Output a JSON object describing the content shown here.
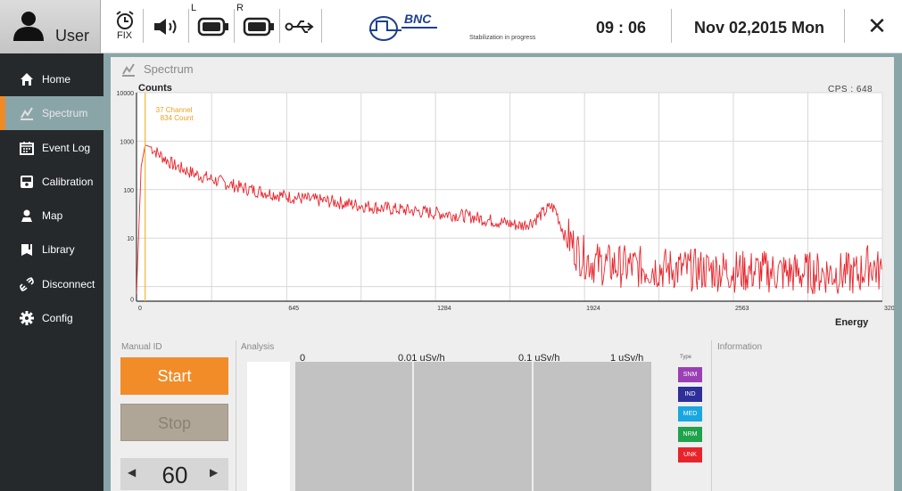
{
  "topbar": {
    "user_label": "User",
    "fix_label": "FIX",
    "left_label": "L",
    "right_label": "R",
    "brand": "BNC",
    "status_text": "Stabilization in progress",
    "time": "09 : 06",
    "date": "Nov 02,2015 Mon",
    "close": "✕",
    "icons": [
      "user-icon",
      "alarm-clock-icon",
      "speaker-icon",
      "battery-left-icon",
      "battery-right-icon",
      "usb-icon",
      "bnc-logo-icon",
      "close-icon"
    ]
  },
  "sidebar": {
    "items": [
      {
        "label": "Home",
        "icon": "home-icon"
      },
      {
        "label": "Spectrum",
        "icon": "spectrum-icon"
      },
      {
        "label": "Event Log",
        "icon": "calendar-icon"
      },
      {
        "label": "Calibration",
        "icon": "calibration-icon"
      },
      {
        "label": "Map",
        "icon": "map-pin-icon"
      },
      {
        "label": "Library",
        "icon": "book-icon"
      },
      {
        "label": "Disconnect",
        "icon": "disconnect-icon"
      },
      {
        "label": "Config",
        "icon": "gear-icon"
      }
    ],
    "active_index": 1
  },
  "main": {
    "title": "Spectrum",
    "cps": "CPS : 648",
    "marker_line1": "37 Channel",
    "marker_line2": "834 Count",
    "manual_id_label": "Manual ID",
    "start_label": "Start",
    "stop_label": "Stop",
    "stepper_value": "60",
    "stepper_left": "◀",
    "stepper_right": "▶",
    "analysis_label": "Analysis",
    "information_label": "Information",
    "scale": [
      "0",
      "0.01 uSv/h",
      "0.1 uSv/h",
      "1 uSv/h"
    ],
    "type_label": "Type",
    "types": [
      {
        "label": "SNM",
        "color": "#9b3fb5"
      },
      {
        "label": "IND",
        "color": "#2d2f9a"
      },
      {
        "label": "MED",
        "color": "#19a7e0"
      },
      {
        "label": "NRM",
        "color": "#1fa24a"
      },
      {
        "label": "UNK",
        "color": "#e8232a"
      }
    ]
  },
  "chart_data": {
    "type": "line",
    "title": "",
    "xlabel": "Energy",
    "ylabel": "Counts",
    "x_scale": "linear",
    "y_scale": "log",
    "xlim": [
      0,
      3203
    ],
    "ylim": [
      0.5,
      10000
    ],
    "x_ticks": [
      "0",
      "645",
      "1284",
      "1924",
      "2563",
      "3203"
    ],
    "y_ticks": [
      "10000",
      "1000",
      "100",
      "10",
      "0"
    ],
    "marker": {
      "channel": 37,
      "count": 834
    },
    "grid": true,
    "series_color": "#e8232a",
    "marker_color": "#f5b731",
    "series": [
      {
        "x": [
          0,
          20,
          37,
          60,
          100,
          160,
          250,
          350,
          450,
          550,
          650,
          750,
          850,
          950,
          1050,
          1150,
          1250,
          1350,
          1450,
          1500,
          1550,
          1600,
          1650,
          1700,
          1750,
          1780,
          1800,
          1820,
          1850,
          1900,
          1950,
          2000,
          2100,
          2200,
          2300,
          2400,
          2500,
          2600,
          2700,
          2800,
          2900,
          3000,
          3100,
          3150,
          3203
        ],
        "y": [
          0.7,
          300,
          834,
          760,
          520,
          320,
          210,
          150,
          110,
          88,
          72,
          62,
          56,
          48,
          42,
          38,
          34,
          31,
          27,
          24,
          22,
          20,
          18,
          22,
          34,
          45,
          38,
          20,
          8,
          3.5,
          2.4,
          2.1,
          1.9,
          1.8,
          1.7,
          1.6,
          1.6,
          1.5,
          1.5,
          1.4,
          1.4,
          1.4,
          1.3,
          2.2,
          1.3
        ]
      }
    ]
  }
}
